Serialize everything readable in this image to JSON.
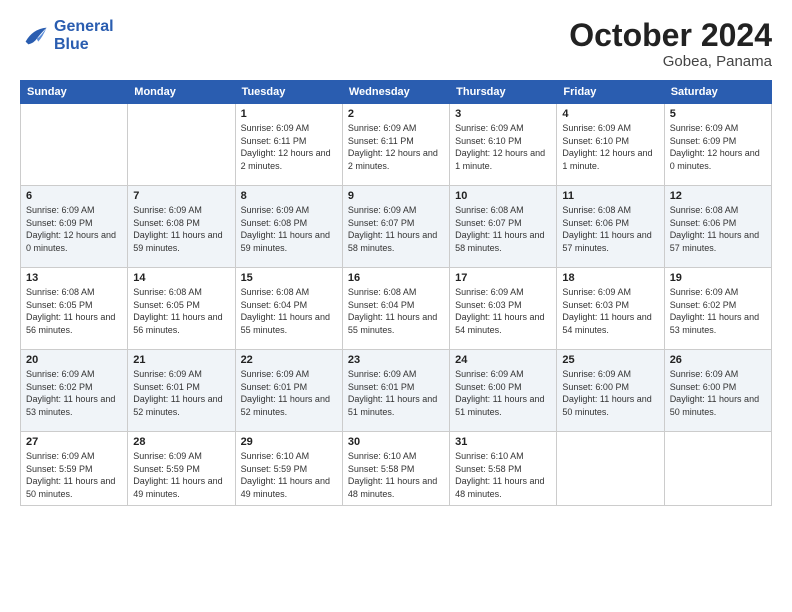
{
  "logo": {
    "line1": "General",
    "line2": "Blue"
  },
  "title": "October 2024",
  "location": "Gobea, Panama",
  "days_of_week": [
    "Sunday",
    "Monday",
    "Tuesday",
    "Wednesday",
    "Thursday",
    "Friday",
    "Saturday"
  ],
  "weeks": [
    [
      {
        "day": "",
        "info": ""
      },
      {
        "day": "",
        "info": ""
      },
      {
        "day": "1",
        "info": "Sunrise: 6:09 AM\nSunset: 6:11 PM\nDaylight: 12 hours\nand 2 minutes."
      },
      {
        "day": "2",
        "info": "Sunrise: 6:09 AM\nSunset: 6:11 PM\nDaylight: 12 hours\nand 2 minutes."
      },
      {
        "day": "3",
        "info": "Sunrise: 6:09 AM\nSunset: 6:10 PM\nDaylight: 12 hours\nand 1 minute."
      },
      {
        "day": "4",
        "info": "Sunrise: 6:09 AM\nSunset: 6:10 PM\nDaylight: 12 hours\nand 1 minute."
      },
      {
        "day": "5",
        "info": "Sunrise: 6:09 AM\nSunset: 6:09 PM\nDaylight: 12 hours\nand 0 minutes."
      }
    ],
    [
      {
        "day": "6",
        "info": "Sunrise: 6:09 AM\nSunset: 6:09 PM\nDaylight: 12 hours\nand 0 minutes."
      },
      {
        "day": "7",
        "info": "Sunrise: 6:09 AM\nSunset: 6:08 PM\nDaylight: 11 hours\nand 59 minutes."
      },
      {
        "day": "8",
        "info": "Sunrise: 6:09 AM\nSunset: 6:08 PM\nDaylight: 11 hours\nand 59 minutes."
      },
      {
        "day": "9",
        "info": "Sunrise: 6:09 AM\nSunset: 6:07 PM\nDaylight: 11 hours\nand 58 minutes."
      },
      {
        "day": "10",
        "info": "Sunrise: 6:08 AM\nSunset: 6:07 PM\nDaylight: 11 hours\nand 58 minutes."
      },
      {
        "day": "11",
        "info": "Sunrise: 6:08 AM\nSunset: 6:06 PM\nDaylight: 11 hours\nand 57 minutes."
      },
      {
        "day": "12",
        "info": "Sunrise: 6:08 AM\nSunset: 6:06 PM\nDaylight: 11 hours\nand 57 minutes."
      }
    ],
    [
      {
        "day": "13",
        "info": "Sunrise: 6:08 AM\nSunset: 6:05 PM\nDaylight: 11 hours\nand 56 minutes."
      },
      {
        "day": "14",
        "info": "Sunrise: 6:08 AM\nSunset: 6:05 PM\nDaylight: 11 hours\nand 56 minutes."
      },
      {
        "day": "15",
        "info": "Sunrise: 6:08 AM\nSunset: 6:04 PM\nDaylight: 11 hours\nand 55 minutes."
      },
      {
        "day": "16",
        "info": "Sunrise: 6:08 AM\nSunset: 6:04 PM\nDaylight: 11 hours\nand 55 minutes."
      },
      {
        "day": "17",
        "info": "Sunrise: 6:09 AM\nSunset: 6:03 PM\nDaylight: 11 hours\nand 54 minutes."
      },
      {
        "day": "18",
        "info": "Sunrise: 6:09 AM\nSunset: 6:03 PM\nDaylight: 11 hours\nand 54 minutes."
      },
      {
        "day": "19",
        "info": "Sunrise: 6:09 AM\nSunset: 6:02 PM\nDaylight: 11 hours\nand 53 minutes."
      }
    ],
    [
      {
        "day": "20",
        "info": "Sunrise: 6:09 AM\nSunset: 6:02 PM\nDaylight: 11 hours\nand 53 minutes."
      },
      {
        "day": "21",
        "info": "Sunrise: 6:09 AM\nSunset: 6:01 PM\nDaylight: 11 hours\nand 52 minutes."
      },
      {
        "day": "22",
        "info": "Sunrise: 6:09 AM\nSunset: 6:01 PM\nDaylight: 11 hours\nand 52 minutes."
      },
      {
        "day": "23",
        "info": "Sunrise: 6:09 AM\nSunset: 6:01 PM\nDaylight: 11 hours\nand 51 minutes."
      },
      {
        "day": "24",
        "info": "Sunrise: 6:09 AM\nSunset: 6:00 PM\nDaylight: 11 hours\nand 51 minutes."
      },
      {
        "day": "25",
        "info": "Sunrise: 6:09 AM\nSunset: 6:00 PM\nDaylight: 11 hours\nand 50 minutes."
      },
      {
        "day": "26",
        "info": "Sunrise: 6:09 AM\nSunset: 6:00 PM\nDaylight: 11 hours\nand 50 minutes."
      }
    ],
    [
      {
        "day": "27",
        "info": "Sunrise: 6:09 AM\nSunset: 5:59 PM\nDaylight: 11 hours\nand 50 minutes."
      },
      {
        "day": "28",
        "info": "Sunrise: 6:09 AM\nSunset: 5:59 PM\nDaylight: 11 hours\nand 49 minutes."
      },
      {
        "day": "29",
        "info": "Sunrise: 6:10 AM\nSunset: 5:59 PM\nDaylight: 11 hours\nand 49 minutes."
      },
      {
        "day": "30",
        "info": "Sunrise: 6:10 AM\nSunset: 5:58 PM\nDaylight: 11 hours\nand 48 minutes."
      },
      {
        "day": "31",
        "info": "Sunrise: 6:10 AM\nSunset: 5:58 PM\nDaylight: 11 hours\nand 48 minutes."
      },
      {
        "day": "",
        "info": ""
      },
      {
        "day": "",
        "info": ""
      }
    ]
  ]
}
